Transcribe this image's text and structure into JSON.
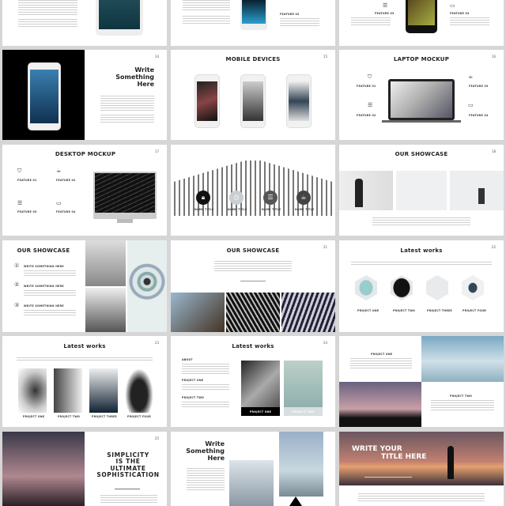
{
  "slides": {
    "write1": {
      "num": "14",
      "title_lines": [
        "Write",
        "Something",
        "Here"
      ]
    },
    "mobile": {
      "num": "15",
      "title": "MOBILE DEVICES"
    },
    "laptop": {
      "num": "16",
      "title": "LAPTOP MOCKUP",
      "features": [
        "FEATURE 01",
        "FEATURE 02",
        "FEATURE 03",
        "FEATURE 04"
      ]
    },
    "desktop": {
      "num": "17",
      "title": "DESKTOP MOCKUP",
      "features": [
        "FEATURE 01",
        "FEATURE 02",
        "FEATURE 03",
        "FEATURE 04"
      ]
    },
    "team": {
      "names": [
        "NAME TITLE",
        "NAME TITLE",
        "NAME TITLE",
        "NAME TITLE"
      ]
    },
    "showcase1": {
      "num": "18",
      "title": "OUR SHOWCASE"
    },
    "showcase2": {
      "title": "OUR SHOWCASE",
      "items": [
        "WRITE SOMETHING HERE",
        "WRITE SOMETHING HERE",
        "WRITE SOMETHING HERE"
      ]
    },
    "showcase3": {
      "num": "21",
      "title": "OUR SHOWCASE"
    },
    "latest1": {
      "num": "22",
      "title": "Latest works",
      "projects": [
        "PROJECT ONE",
        "PROJECT TWO",
        "PROJECT THREE",
        "PROJECT FOUR"
      ]
    },
    "latest2": {
      "num": "23",
      "title": "Latest works",
      "projects": [
        "PROJECT ONE",
        "PROJECT TWO",
        "PROJECT THREE",
        "PROJECT FOUR"
      ]
    },
    "latest3": {
      "num": "24",
      "title": "Latest works",
      "sections": [
        "ABOUT",
        "PROJECT ONE",
        "PROJECT TWO"
      ],
      "cards": [
        "PROJECT ONE",
        "PROJECT TWO"
      ]
    },
    "projects": {
      "labels": [
        "PROJECT ONE",
        "PROJECT TWO"
      ]
    },
    "simplicity": {
      "num": "25",
      "title_lines": [
        "SIMPLICITY",
        "IS THE",
        "ULTIMATE",
        "SOPHISTICATION"
      ]
    },
    "write2": {
      "title_lines": [
        "Write",
        "Something",
        "Here"
      ]
    },
    "banner": {
      "title_lines": [
        "WRITE YOUR",
        "TITLE HERE"
      ]
    },
    "top": {
      "feature2": "FEATURE 02",
      "feature3": "FEATURE 03",
      "feature4": "FEATURE 04"
    }
  }
}
